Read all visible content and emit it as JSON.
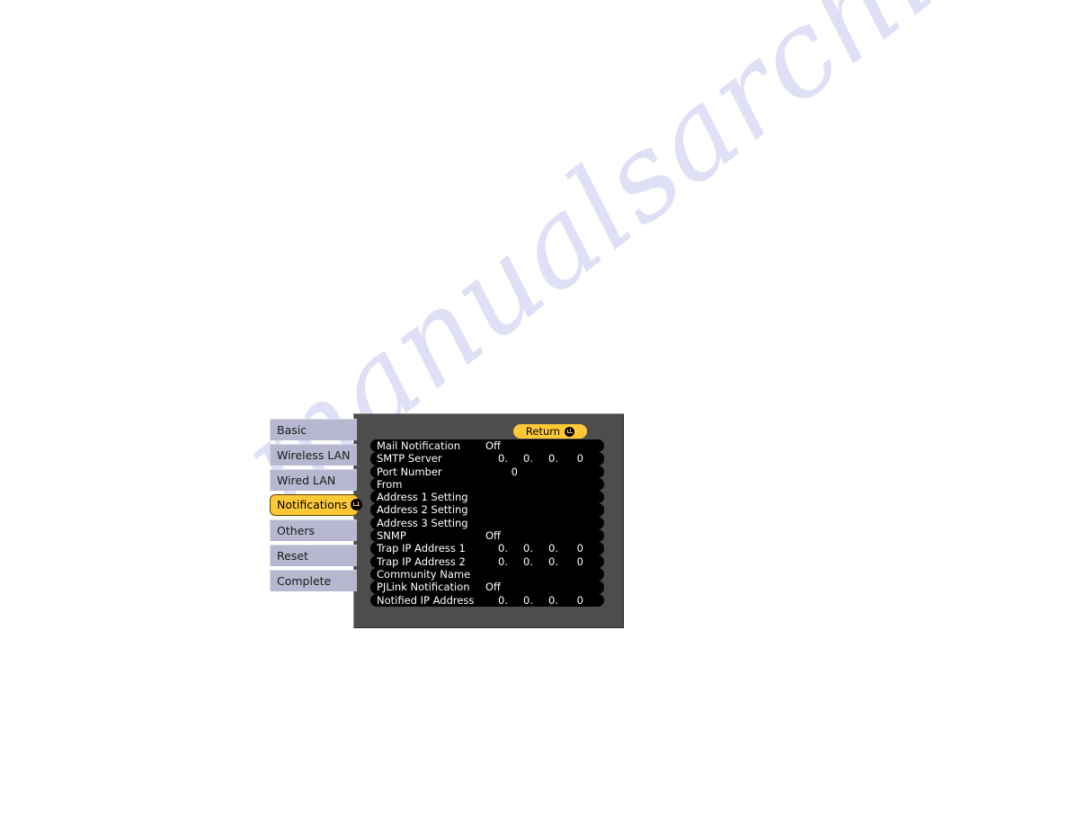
{
  "watermark": {
    "text": "manualsarchive.com"
  },
  "osd": {
    "tabs": [
      {
        "label": "Basic",
        "active": false,
        "icon": null
      },
      {
        "label": "Wireless LAN",
        "active": false,
        "icon": null
      },
      {
        "label": "Wired LAN",
        "active": false,
        "icon": null
      },
      {
        "label": "Notifications",
        "active": true,
        "icon": "enter-icon"
      },
      {
        "label": "Others",
        "active": false,
        "icon": null
      },
      {
        "label": "Reset",
        "active": false,
        "icon": null
      },
      {
        "label": "Complete",
        "active": false,
        "icon": null
      }
    ],
    "return_button": {
      "label": "Return",
      "icon": "enter-icon"
    },
    "items": [
      {
        "label": "Mail Notification",
        "value": "Off",
        "type": "text"
      },
      {
        "label": "SMTP Server",
        "value": [
          "0.",
          "0.",
          "0.",
          "0"
        ],
        "type": "ip"
      },
      {
        "label": "Port Number",
        "value": "0",
        "type": "port"
      },
      {
        "label": "From",
        "value": "",
        "type": "none"
      },
      {
        "label": "Address 1 Setting",
        "value": "",
        "type": "none"
      },
      {
        "label": "Address 2 Setting",
        "value": "",
        "type": "none"
      },
      {
        "label": "Address 3 Setting",
        "value": "",
        "type": "none"
      },
      {
        "label": "SNMP",
        "value": "Off",
        "type": "text"
      },
      {
        "label": "Trap IP Address 1",
        "value": [
          "0.",
          "0.",
          "0.",
          "0"
        ],
        "type": "ip"
      },
      {
        "label": "Trap IP Address 2",
        "value": [
          "0.",
          "0.",
          "0.",
          "0"
        ],
        "type": "ip"
      },
      {
        "label": "Community Name",
        "value": "",
        "type": "none"
      },
      {
        "label": "PJLink Notification",
        "value": "Off",
        "type": "text"
      },
      {
        "label": "Notified IP Address",
        "value": [
          "0.",
          "0.",
          "0.",
          "0"
        ],
        "type": "ip"
      }
    ],
    "colors": {
      "panel_bg": "#4d4d4d",
      "row_bg": "#000000",
      "tab_bg": "#b7b7d0",
      "tab_active_bg": "#ffc936",
      "accent": "#ffc936",
      "text": "#ffffff",
      "watermark": "#ccccf2"
    }
  }
}
